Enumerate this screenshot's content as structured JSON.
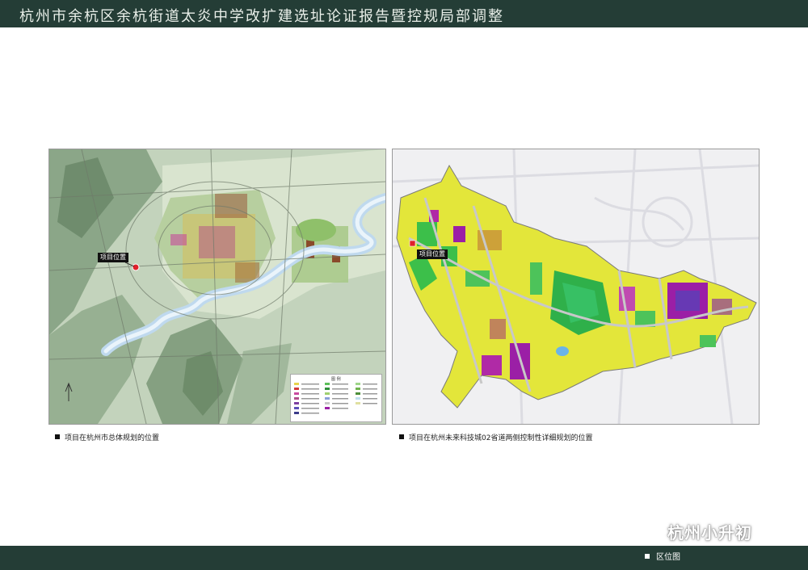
{
  "header": {
    "title": "杭州市余杭区余杭街道太炎中学改扩建选址论证报告暨控规局部调整"
  },
  "maps": {
    "left": {
      "marker_label": "项目位置",
      "caption": "项目在杭州市总体规划的位置",
      "legend_title": "图 例"
    },
    "right": {
      "marker_label": "项目位置",
      "caption": "项目在杭州未来科技城02省道两侧控制性详细规划的位置"
    }
  },
  "watermark": {
    "text": "杭州小升初",
    "icon": "wechat-icon"
  },
  "footer": {
    "label": "区位图"
  },
  "colors": {
    "header_bg": "#243d36",
    "marker": "#e0202a",
    "landuse_yellow": "#e6e83a",
    "landuse_green": "#3cbf4a",
    "landuse_purple": "#9b1fa6",
    "landuse_blue": "#5064c8"
  }
}
